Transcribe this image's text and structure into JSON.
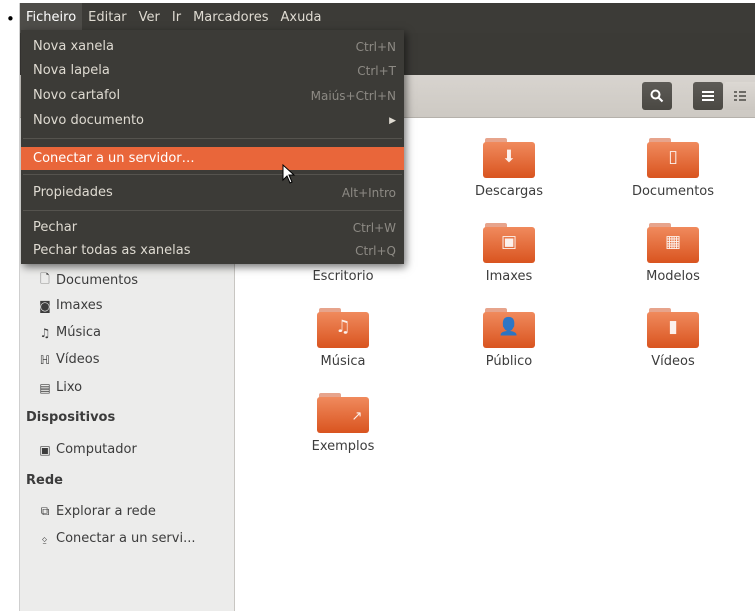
{
  "menubar": {
    "items": [
      "Ficheiro",
      "Editar",
      "Ver",
      "Ir",
      "Marcadores",
      "Axuda"
    ]
  },
  "file_menu": {
    "items": [
      {
        "label": "Nova xanela",
        "accel": "Ctrl+N"
      },
      {
        "label": "Nova lapela",
        "accel": "Ctrl+T"
      },
      {
        "label": "Novo cartafol",
        "accel": "Maiús+Ctrl+N"
      },
      {
        "label": "Novo documento",
        "accel": ""
      },
      {
        "label": "Conectar a un servidor…",
        "accel": ""
      },
      {
        "label": "Propiedades",
        "accel": "Alt+Intro"
      },
      {
        "label": "Pechar",
        "accel": "Ctrl+W"
      },
      {
        "label": "Pechar todas as xanelas",
        "accel": "Ctrl+Q"
      }
    ],
    "highlighted_index": 4,
    "highlight_color": "#e9663a"
  },
  "toolbar": {
    "search_icon": "search-icon",
    "list_view_icon": "list-view-icon",
    "grid_view_icon": "grid-view-icon"
  },
  "sidebar": {
    "places": [
      {
        "label": "Documentos",
        "icon": "document-icon"
      },
      {
        "label": "Imaxes",
        "icon": "camera-icon"
      },
      {
        "label": "Música",
        "icon": "music-icon"
      },
      {
        "label": "Vídeos",
        "icon": "video-icon"
      },
      {
        "label": "Lixo",
        "icon": "trash-icon"
      }
    ],
    "devices_heading": "Dispositivos",
    "devices": [
      {
        "label": "Computador",
        "icon": "computer-icon"
      }
    ],
    "network_heading": "Rede",
    "network": [
      {
        "label": "Explorar a rede",
        "icon": "network-icon"
      },
      {
        "label": "Conectar a un servi...",
        "icon": "server-icon"
      }
    ]
  },
  "folders": [
    {
      "label": "Descargas",
      "icon": "download-folder-icon"
    },
    {
      "label": "Documentos",
      "icon": "documents-folder-icon"
    },
    {
      "label": "Escritorio",
      "icon": "desktop-folder-icon"
    },
    {
      "label": "Imaxes",
      "icon": "pictures-folder-icon"
    },
    {
      "label": "Modelos",
      "icon": "templates-folder-icon"
    },
    {
      "label": "Música",
      "icon": "music-folder-icon"
    },
    {
      "label": "Público",
      "icon": "public-folder-icon"
    },
    {
      "label": "Vídeos",
      "icon": "videos-folder-icon"
    },
    {
      "label": "Exemplos",
      "icon": "examples-folder-icon"
    }
  ],
  "colors": {
    "menubar_bg": "#3c3b37",
    "folder_orange": "#e2642f",
    "sidebar_bg": "#ececeb"
  }
}
